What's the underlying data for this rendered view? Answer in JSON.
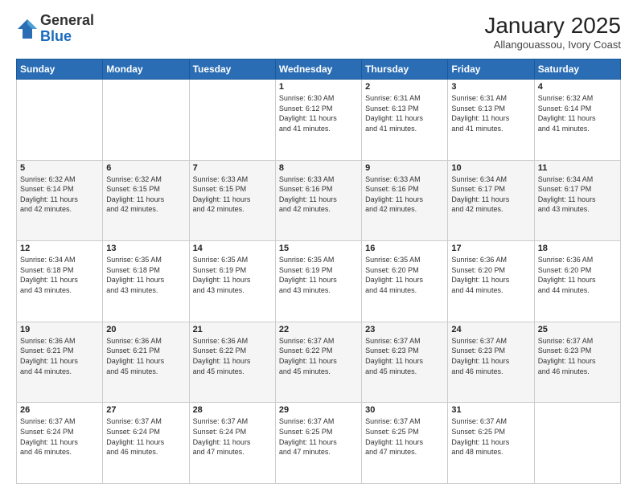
{
  "logo": {
    "general": "General",
    "blue": "Blue"
  },
  "title": "January 2025",
  "location": "Allangouassou, Ivory Coast",
  "weekdays": [
    "Sunday",
    "Monday",
    "Tuesday",
    "Wednesday",
    "Thursday",
    "Friday",
    "Saturday"
  ],
  "weeks": [
    [
      {
        "day": "",
        "info": ""
      },
      {
        "day": "",
        "info": ""
      },
      {
        "day": "",
        "info": ""
      },
      {
        "day": "1",
        "info": "Sunrise: 6:30 AM\nSunset: 6:12 PM\nDaylight: 11 hours\nand 41 minutes."
      },
      {
        "day": "2",
        "info": "Sunrise: 6:31 AM\nSunset: 6:13 PM\nDaylight: 11 hours\nand 41 minutes."
      },
      {
        "day": "3",
        "info": "Sunrise: 6:31 AM\nSunset: 6:13 PM\nDaylight: 11 hours\nand 41 minutes."
      },
      {
        "day": "4",
        "info": "Sunrise: 6:32 AM\nSunset: 6:14 PM\nDaylight: 11 hours\nand 41 minutes."
      }
    ],
    [
      {
        "day": "5",
        "info": "Sunrise: 6:32 AM\nSunset: 6:14 PM\nDaylight: 11 hours\nand 42 minutes."
      },
      {
        "day": "6",
        "info": "Sunrise: 6:32 AM\nSunset: 6:15 PM\nDaylight: 11 hours\nand 42 minutes."
      },
      {
        "day": "7",
        "info": "Sunrise: 6:33 AM\nSunset: 6:15 PM\nDaylight: 11 hours\nand 42 minutes."
      },
      {
        "day": "8",
        "info": "Sunrise: 6:33 AM\nSunset: 6:16 PM\nDaylight: 11 hours\nand 42 minutes."
      },
      {
        "day": "9",
        "info": "Sunrise: 6:33 AM\nSunset: 6:16 PM\nDaylight: 11 hours\nand 42 minutes."
      },
      {
        "day": "10",
        "info": "Sunrise: 6:34 AM\nSunset: 6:17 PM\nDaylight: 11 hours\nand 42 minutes."
      },
      {
        "day": "11",
        "info": "Sunrise: 6:34 AM\nSunset: 6:17 PM\nDaylight: 11 hours\nand 43 minutes."
      }
    ],
    [
      {
        "day": "12",
        "info": "Sunrise: 6:34 AM\nSunset: 6:18 PM\nDaylight: 11 hours\nand 43 minutes."
      },
      {
        "day": "13",
        "info": "Sunrise: 6:35 AM\nSunset: 6:18 PM\nDaylight: 11 hours\nand 43 minutes."
      },
      {
        "day": "14",
        "info": "Sunrise: 6:35 AM\nSunset: 6:19 PM\nDaylight: 11 hours\nand 43 minutes."
      },
      {
        "day": "15",
        "info": "Sunrise: 6:35 AM\nSunset: 6:19 PM\nDaylight: 11 hours\nand 43 minutes."
      },
      {
        "day": "16",
        "info": "Sunrise: 6:35 AM\nSunset: 6:20 PM\nDaylight: 11 hours\nand 44 minutes."
      },
      {
        "day": "17",
        "info": "Sunrise: 6:36 AM\nSunset: 6:20 PM\nDaylight: 11 hours\nand 44 minutes."
      },
      {
        "day": "18",
        "info": "Sunrise: 6:36 AM\nSunset: 6:20 PM\nDaylight: 11 hours\nand 44 minutes."
      }
    ],
    [
      {
        "day": "19",
        "info": "Sunrise: 6:36 AM\nSunset: 6:21 PM\nDaylight: 11 hours\nand 44 minutes."
      },
      {
        "day": "20",
        "info": "Sunrise: 6:36 AM\nSunset: 6:21 PM\nDaylight: 11 hours\nand 45 minutes."
      },
      {
        "day": "21",
        "info": "Sunrise: 6:36 AM\nSunset: 6:22 PM\nDaylight: 11 hours\nand 45 minutes."
      },
      {
        "day": "22",
        "info": "Sunrise: 6:37 AM\nSunset: 6:22 PM\nDaylight: 11 hours\nand 45 minutes."
      },
      {
        "day": "23",
        "info": "Sunrise: 6:37 AM\nSunset: 6:23 PM\nDaylight: 11 hours\nand 45 minutes."
      },
      {
        "day": "24",
        "info": "Sunrise: 6:37 AM\nSunset: 6:23 PM\nDaylight: 11 hours\nand 46 minutes."
      },
      {
        "day": "25",
        "info": "Sunrise: 6:37 AM\nSunset: 6:23 PM\nDaylight: 11 hours\nand 46 minutes."
      }
    ],
    [
      {
        "day": "26",
        "info": "Sunrise: 6:37 AM\nSunset: 6:24 PM\nDaylight: 11 hours\nand 46 minutes."
      },
      {
        "day": "27",
        "info": "Sunrise: 6:37 AM\nSunset: 6:24 PM\nDaylight: 11 hours\nand 46 minutes."
      },
      {
        "day": "28",
        "info": "Sunrise: 6:37 AM\nSunset: 6:24 PM\nDaylight: 11 hours\nand 47 minutes."
      },
      {
        "day": "29",
        "info": "Sunrise: 6:37 AM\nSunset: 6:25 PM\nDaylight: 11 hours\nand 47 minutes."
      },
      {
        "day": "30",
        "info": "Sunrise: 6:37 AM\nSunset: 6:25 PM\nDaylight: 11 hours\nand 47 minutes."
      },
      {
        "day": "31",
        "info": "Sunrise: 6:37 AM\nSunset: 6:25 PM\nDaylight: 11 hours\nand 48 minutes."
      },
      {
        "day": "",
        "info": ""
      }
    ]
  ]
}
